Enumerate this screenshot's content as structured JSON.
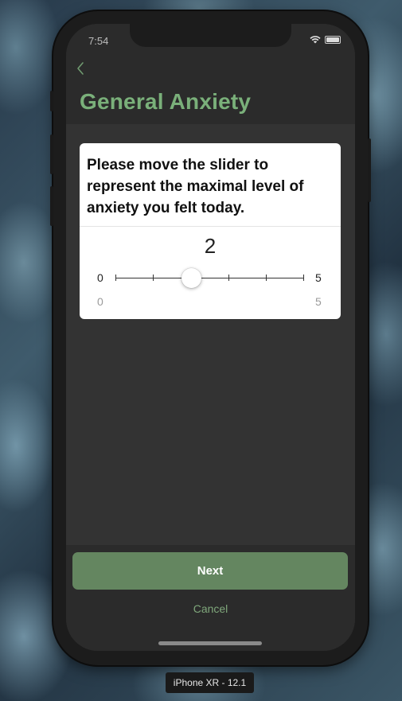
{
  "status_bar": {
    "time": "7:54"
  },
  "nav": {
    "title": "General Anxiety",
    "back_icon": "chevron-left-icon"
  },
  "question": {
    "text": "Please move the slider to represent the maximal level of anxiety you felt today."
  },
  "slider": {
    "value": "2",
    "min_label": "0",
    "max_label": "5",
    "min_description": "0",
    "max_description": "5"
  },
  "footer": {
    "next_label": "Next",
    "cancel_label": "Cancel"
  },
  "device": {
    "label": "iPhone XR - 12.1"
  },
  "colors": {
    "accent_green": "#7ab07a",
    "button_green": "#648660",
    "background": "#2a2a2a"
  }
}
